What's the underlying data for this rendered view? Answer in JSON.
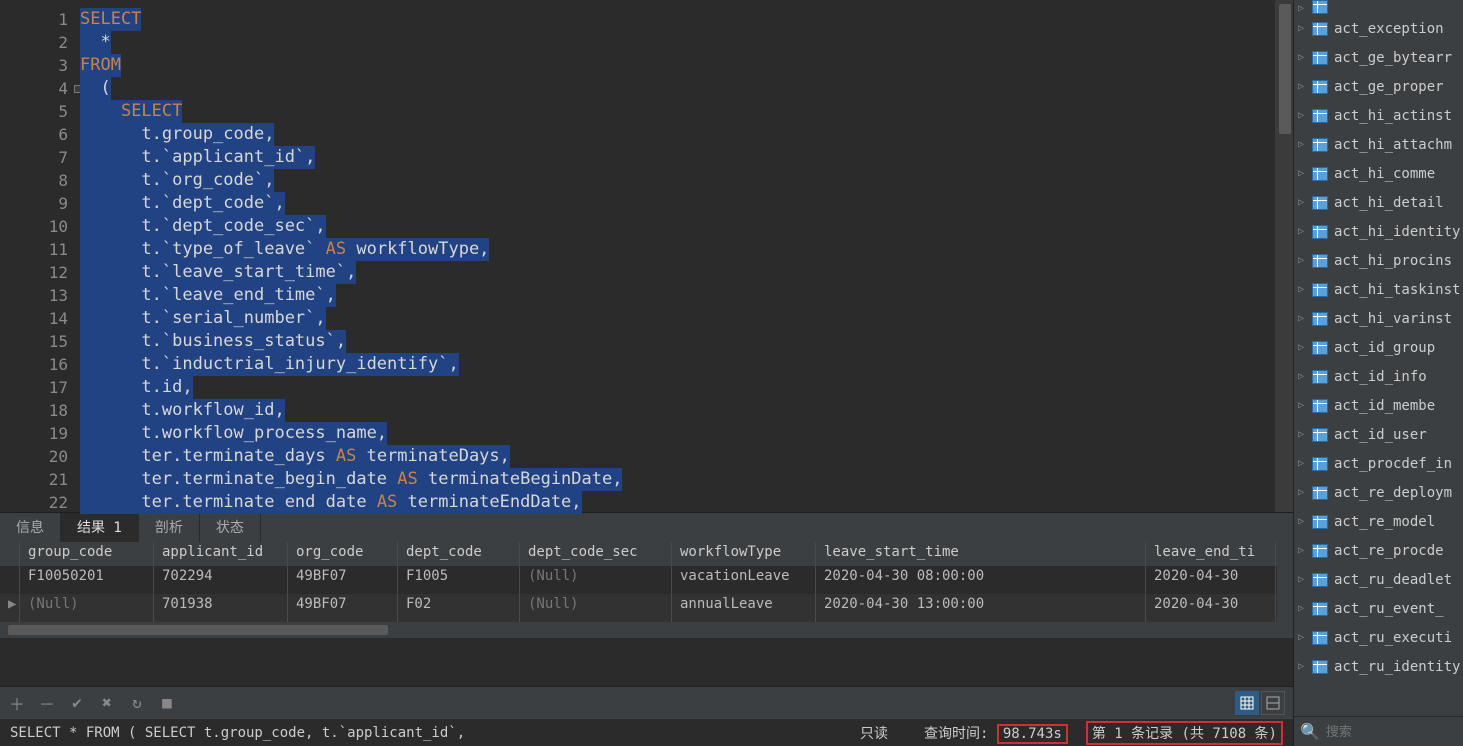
{
  "editor": {
    "lines": [
      {
        "n": 1,
        "segments": [
          {
            "t": "SELECT",
            "c": "kw",
            "sel": true
          }
        ]
      },
      {
        "n": 2,
        "segments": [
          {
            "t": "  *",
            "c": "plain",
            "sel": true
          }
        ]
      },
      {
        "n": 3,
        "segments": [
          {
            "t": "FROM",
            "c": "kw",
            "sel": true
          }
        ]
      },
      {
        "n": 4,
        "segments": [
          {
            "t": "  (",
            "c": "plain",
            "sel": true
          }
        ],
        "fold": true
      },
      {
        "n": 5,
        "segments": [
          {
            "t": "    ",
            "c": "plain",
            "sel": true
          },
          {
            "t": "SELECT",
            "c": "kw",
            "sel": true
          }
        ]
      },
      {
        "n": 6,
        "segments": [
          {
            "t": "      t.group_code,",
            "c": "plain",
            "sel": true
          }
        ]
      },
      {
        "n": 7,
        "segments": [
          {
            "t": "      t.`applicant_id`,",
            "c": "plain",
            "sel": true
          }
        ]
      },
      {
        "n": 8,
        "segments": [
          {
            "t": "      t.`org_code`,",
            "c": "plain",
            "sel": true
          }
        ]
      },
      {
        "n": 9,
        "segments": [
          {
            "t": "      t.`dept_code`,",
            "c": "plain",
            "sel": true
          }
        ]
      },
      {
        "n": 10,
        "segments": [
          {
            "t": "      t.`dept_code_sec`,",
            "c": "plain",
            "sel": true
          }
        ]
      },
      {
        "n": 11,
        "segments": [
          {
            "t": "      t.`type_of_leave` ",
            "c": "plain",
            "sel": true
          },
          {
            "t": "AS",
            "c": "kw",
            "sel": true
          },
          {
            "t": " workflowType,",
            "c": "plain",
            "sel": true
          }
        ]
      },
      {
        "n": 12,
        "segments": [
          {
            "t": "      t.`leave_start_time`,",
            "c": "plain",
            "sel": true
          }
        ]
      },
      {
        "n": 13,
        "segments": [
          {
            "t": "      t.`leave_end_time`,",
            "c": "plain",
            "sel": true
          }
        ]
      },
      {
        "n": 14,
        "segments": [
          {
            "t": "      t.`serial_number`,",
            "c": "plain",
            "sel": true
          }
        ]
      },
      {
        "n": 15,
        "segments": [
          {
            "t": "      t.`business_status`,",
            "c": "plain",
            "sel": true
          }
        ]
      },
      {
        "n": 16,
        "segments": [
          {
            "t": "      t.`inductrial_injury_identify`,",
            "c": "plain",
            "sel": true
          }
        ]
      },
      {
        "n": 17,
        "segments": [
          {
            "t": "      t.id,",
            "c": "plain",
            "sel": true
          }
        ]
      },
      {
        "n": 18,
        "segments": [
          {
            "t": "      t.workflow_id,",
            "c": "plain",
            "sel": true
          }
        ]
      },
      {
        "n": 19,
        "segments": [
          {
            "t": "      t.workflow_process_name,",
            "c": "plain",
            "sel": true
          }
        ]
      },
      {
        "n": 20,
        "segments": [
          {
            "t": "      ter.terminate_days ",
            "c": "plain",
            "sel": true
          },
          {
            "t": "AS",
            "c": "kw",
            "sel": true
          },
          {
            "t": " terminateDays,",
            "c": "plain",
            "sel": true
          }
        ]
      },
      {
        "n": 21,
        "segments": [
          {
            "t": "      ter.terminate_begin_date ",
            "c": "plain",
            "sel": true
          },
          {
            "t": "AS",
            "c": "kw",
            "sel": true
          },
          {
            "t": " terminateBeginDate,",
            "c": "plain",
            "sel": true
          }
        ]
      },
      {
        "n": 22,
        "segments": [
          {
            "t": "      ter.terminate end date ",
            "c": "plain",
            "sel": true
          },
          {
            "t": "AS",
            "c": "kw",
            "sel": true
          },
          {
            "t": " terminateEndDate,",
            "c": "plain",
            "sel": true
          }
        ]
      }
    ]
  },
  "tabs": [
    {
      "label": "信息",
      "active": false
    },
    {
      "label": "结果 1",
      "active": true
    },
    {
      "label": "剖析",
      "active": false
    },
    {
      "label": "状态",
      "active": false
    }
  ],
  "grid": {
    "columns": [
      "group_code",
      "applicant_id",
      "org_code",
      "dept_code",
      "dept_code_sec",
      "workflowType",
      "leave_start_time",
      "leave_end_ti"
    ],
    "rows": [
      {
        "marker": "▶",
        "cells": [
          "(Null)",
          "701938",
          "49BF07",
          "F02",
          "(Null)",
          "annualLeave",
          "2020-04-30 13:00:00",
          "2020-04-30"
        ]
      },
      {
        "marker": "",
        "cells": [
          "F10050201",
          "702294",
          "49BF07",
          "F1005",
          "(Null)",
          "vacationLeave",
          "2020-04-30 08:00:00",
          "2020-04-30"
        ]
      }
    ]
  },
  "status": {
    "sql": "SELECT    *  FROM    (        SELECT            t.group_code,            t.`applicant_id`,",
    "mode": "只读",
    "query_label": "查询时间:",
    "query_time": "98.743s",
    "record": "第 1 条记录 (共 7108 条)"
  },
  "sidebar": {
    "tables": [
      "act_exception",
      "act_ge_bytearr",
      "act_ge_proper",
      "act_hi_actinst",
      "act_hi_attachm",
      "act_hi_comme",
      "act_hi_detail",
      "act_hi_identity",
      "act_hi_procins",
      "act_hi_taskinst",
      "act_hi_varinst",
      "act_id_group",
      "act_id_info",
      "act_id_membe",
      "act_id_user",
      "act_procdef_in",
      "act_re_deploym",
      "act_re_model",
      "act_re_procde",
      "act_ru_deadlet",
      "act_ru_event_",
      "act_ru_executi",
      "act_ru_identity"
    ],
    "search_placeholder": "搜索"
  }
}
